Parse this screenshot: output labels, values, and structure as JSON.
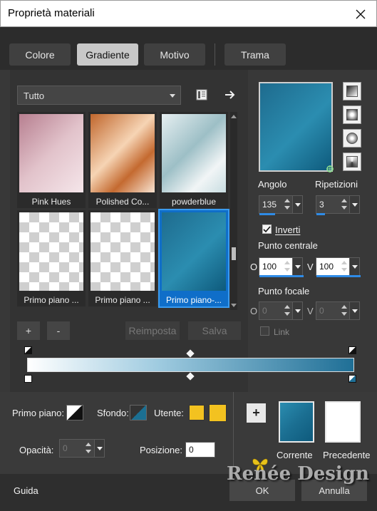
{
  "window": {
    "title": "Proprietà materiali"
  },
  "tabs": [
    {
      "label": "Colore"
    },
    {
      "label": "Gradiente"
    },
    {
      "label": "Motivo"
    },
    {
      "label": "Trama"
    }
  ],
  "category": {
    "selected": "Tutto"
  },
  "gradients": [
    {
      "label": "Pink Hues"
    },
    {
      "label": "Polished Co..."
    },
    {
      "label": "powderblue"
    },
    {
      "label": "Primo piano ..."
    },
    {
      "label": "Primo piano ..."
    },
    {
      "label": "Primo piano-..."
    }
  ],
  "gallery_buttons": {
    "add": "+",
    "remove": "-",
    "reset": "Reimposta",
    "save": "Salva"
  },
  "props": {
    "angle_label": "Angolo",
    "angle_value": "135",
    "repeat_label": "Ripetizioni",
    "repeat_value": "3",
    "invert_label": "Inverti",
    "invert_checked": true,
    "center_label": "Punto centrale",
    "center_h": "100",
    "center_v": "100",
    "focal_label": "Punto focale",
    "focal_h": "0",
    "focal_v": "0",
    "link_label": "Link",
    "axis_o": "O",
    "axis_v": "V"
  },
  "bottom": {
    "foreground_label": "Primo piano:",
    "background_label": "Sfondo:",
    "user_label": "Utente:",
    "opacity_label": "Opacità:",
    "opacity_value": "0",
    "position_label": "Posizione:",
    "position_value": "0",
    "add_symbol": "+",
    "current_label": "Corrente",
    "previous_label": "Precedente"
  },
  "footer": {
    "help": "Guida",
    "ok": "OK",
    "cancel": "Annulla"
  },
  "watermark": "Renée Design",
  "colors": {
    "gradient_start": "#ffffff",
    "gradient_mid": "#9fcbe0",
    "gradient_end": "#1f6f96",
    "current_swatch": "#1b6f92",
    "previous_swatch": "#ffffff",
    "user_color": "#f3c220",
    "selection": "#0f6ec9"
  }
}
